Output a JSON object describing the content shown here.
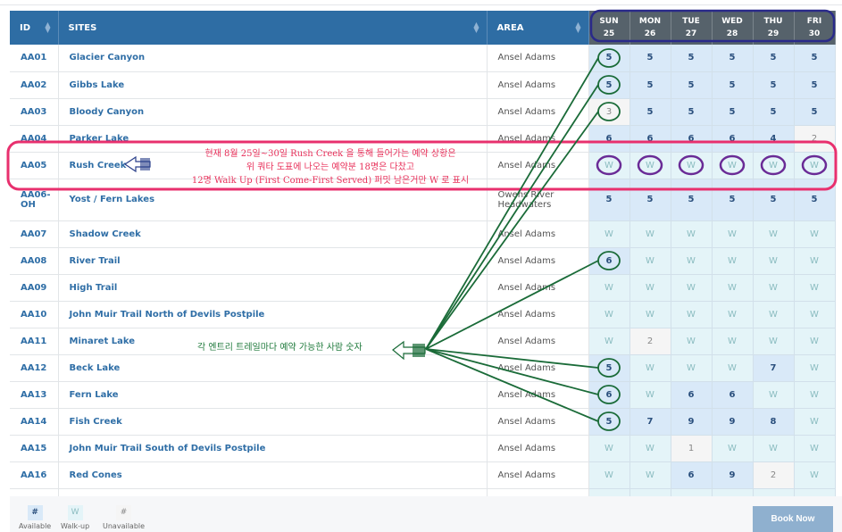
{
  "headers": {
    "id": "ID",
    "sites": "SITES",
    "area": "AREA"
  },
  "days": [
    {
      "d": "SUN",
      "n": "25"
    },
    {
      "d": "MON",
      "n": "26"
    },
    {
      "d": "TUE",
      "n": "27"
    },
    {
      "d": "WED",
      "n": "28"
    },
    {
      "d": "THU",
      "n": "29"
    },
    {
      "d": "FRI",
      "n": "30"
    }
  ],
  "rows": [
    {
      "id": "AA01",
      "site": "Glacier Canyon",
      "area": "Ansel Adams",
      "cells": [
        [
          "5",
          "a"
        ],
        [
          "5",
          "a"
        ],
        [
          "5",
          "a"
        ],
        [
          "5",
          "a"
        ],
        [
          "5",
          "a"
        ],
        [
          "5",
          "a"
        ]
      ]
    },
    {
      "id": "AA02",
      "site": "Gibbs Lake",
      "area": "Ansel Adams",
      "cells": [
        [
          "5",
          "a"
        ],
        [
          "5",
          "a"
        ],
        [
          "5",
          "a"
        ],
        [
          "5",
          "a"
        ],
        [
          "5",
          "a"
        ],
        [
          "5",
          "a"
        ]
      ]
    },
    {
      "id": "AA03",
      "site": "Bloody Canyon",
      "area": "Ansel Adams",
      "cells": [
        [
          "3",
          "u"
        ],
        [
          "5",
          "a"
        ],
        [
          "5",
          "a"
        ],
        [
          "5",
          "a"
        ],
        [
          "5",
          "a"
        ],
        [
          "5",
          "a"
        ]
      ]
    },
    {
      "id": "AA04",
      "site": "Parker Lake",
      "area": "Ansel Adams",
      "cells": [
        [
          "6",
          "a"
        ],
        [
          "6",
          "a"
        ],
        [
          "6",
          "a"
        ],
        [
          "6",
          "a"
        ],
        [
          "4",
          "a"
        ],
        [
          "2",
          "u"
        ]
      ]
    },
    {
      "id": "AA05",
      "site": "Rush Creek",
      "area": "Ansel Adams",
      "cells": [
        [
          "W",
          "w"
        ],
        [
          "W",
          "w"
        ],
        [
          "W",
          "w"
        ],
        [
          "W",
          "w"
        ],
        [
          "W",
          "w"
        ],
        [
          "W",
          "w"
        ]
      ]
    },
    {
      "id": "AA06-OH",
      "site": "Yost / Fern Lakes",
      "area": "Owens River Headwaters",
      "cells": [
        [
          "5",
          "a"
        ],
        [
          "5",
          "a"
        ],
        [
          "5",
          "a"
        ],
        [
          "5",
          "a"
        ],
        [
          "5",
          "a"
        ],
        [
          "5",
          "a"
        ]
      ]
    },
    {
      "id": "AA07",
      "site": "Shadow Creek",
      "area": "Ansel Adams",
      "cells": [
        [
          "W",
          "w"
        ],
        [
          "W",
          "w"
        ],
        [
          "W",
          "w"
        ],
        [
          "W",
          "w"
        ],
        [
          "W",
          "w"
        ],
        [
          "W",
          "w"
        ]
      ]
    },
    {
      "id": "AA08",
      "site": "River Trail",
      "area": "Ansel Adams",
      "cells": [
        [
          "6",
          "a"
        ],
        [
          "W",
          "w"
        ],
        [
          "W",
          "w"
        ],
        [
          "W",
          "w"
        ],
        [
          "W",
          "w"
        ],
        [
          "W",
          "w"
        ]
      ]
    },
    {
      "id": "AA09",
      "site": "High Trail",
      "area": "Ansel Adams",
      "cells": [
        [
          "W",
          "w"
        ],
        [
          "W",
          "w"
        ],
        [
          "W",
          "w"
        ],
        [
          "W",
          "w"
        ],
        [
          "W",
          "w"
        ],
        [
          "W",
          "w"
        ]
      ]
    },
    {
      "id": "AA10",
      "site": "John Muir Trail North of Devils Postpile",
      "area": "Ansel Adams",
      "cells": [
        [
          "W",
          "w"
        ],
        [
          "W",
          "w"
        ],
        [
          "W",
          "w"
        ],
        [
          "W",
          "w"
        ],
        [
          "W",
          "w"
        ],
        [
          "W",
          "w"
        ]
      ]
    },
    {
      "id": "AA11",
      "site": "Minaret Lake",
      "area": "Ansel Adams",
      "cells": [
        [
          "W",
          "w"
        ],
        [
          "2",
          "u"
        ],
        [
          "W",
          "w"
        ],
        [
          "W",
          "w"
        ],
        [
          "W",
          "w"
        ],
        [
          "W",
          "w"
        ]
      ]
    },
    {
      "id": "AA12",
      "site": "Beck Lake",
      "area": "Ansel Adams",
      "cells": [
        [
          "5",
          "a"
        ],
        [
          "W",
          "w"
        ],
        [
          "W",
          "w"
        ],
        [
          "W",
          "w"
        ],
        [
          "7",
          "a"
        ],
        [
          "W",
          "w"
        ]
      ]
    },
    {
      "id": "AA13",
      "site": "Fern Lake",
      "area": "Ansel Adams",
      "cells": [
        [
          "6",
          "a"
        ],
        [
          "W",
          "w"
        ],
        [
          "6",
          "a"
        ],
        [
          "6",
          "a"
        ],
        [
          "W",
          "w"
        ],
        [
          "W",
          "w"
        ]
      ]
    },
    {
      "id": "AA14",
      "site": "Fish Creek",
      "area": "Ansel Adams",
      "cells": [
        [
          "5",
          "a"
        ],
        [
          "7",
          "a"
        ],
        [
          "9",
          "a"
        ],
        [
          "9",
          "a"
        ],
        [
          "8",
          "a"
        ],
        [
          "W",
          "w"
        ]
      ]
    },
    {
      "id": "AA15",
      "site": "John Muir Trail South of Devils Postpile",
      "area": "Ansel Adams",
      "cells": [
        [
          "W",
          "w"
        ],
        [
          "W",
          "w"
        ],
        [
          "1",
          "u"
        ],
        [
          "W",
          "w"
        ],
        [
          "W",
          "w"
        ],
        [
          "W",
          "w"
        ]
      ]
    },
    {
      "id": "AA16",
      "site": "Red Cones",
      "area": "Ansel Adams",
      "cells": [
        [
          "W",
          "w"
        ],
        [
          "W",
          "w"
        ],
        [
          "6",
          "a"
        ],
        [
          "9",
          "a"
        ],
        [
          "2",
          "u"
        ],
        [
          "W",
          "w"
        ]
      ]
    }
  ],
  "legend": [
    {
      "sym": "#",
      "label": "Available"
    },
    {
      "sym": "W",
      "label": "Walk-up"
    },
    {
      "sym": "#",
      "label": "Unavailable"
    }
  ],
  "book_now": "Book Now",
  "annotations": {
    "rush_note": [
      "현재 8월 25일~30일 Rush Creek 을 통해 들어가는 예약 상황은",
      "위 쿼타 도표에 나오는 예약분 18명은 다찼고",
      "12명 Walk Up (First Come-First Served) 퍼밋 남은거만 W 로 표시"
    ],
    "count_note": "각 엔트리 트레일마다 예약 가능한 사람 숫자"
  },
  "colors": {
    "header": "#2e6da4",
    "day_header": "#56626b",
    "available": "#d9e9f8",
    "walkup": "#e4f4f8",
    "unavailable": "#f5f5f5",
    "note_red": "#e8305a",
    "note_green": "#1f7a3c"
  }
}
